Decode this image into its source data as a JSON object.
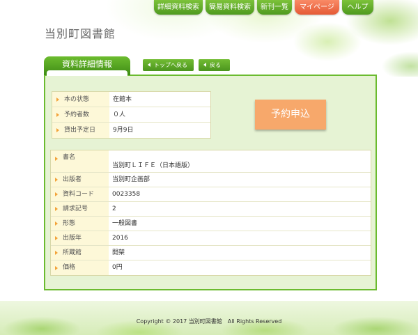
{
  "nav": {
    "items": [
      {
        "label": "詳細資料検索"
      },
      {
        "label": "簡易資料検索"
      },
      {
        "label": "新刊一覧"
      },
      {
        "label": "マイページ"
      },
      {
        "label": "ヘルプ"
      }
    ]
  },
  "site": {
    "title": "当別町図書館"
  },
  "section": {
    "tab_label": "資料詳細情報",
    "top_button": "トップへ戻る",
    "back_button": "戻る"
  },
  "status": {
    "rows": [
      {
        "label": "本の状態",
        "value": "在館本"
      },
      {
        "label": "予約者数",
        "value": "０人"
      },
      {
        "label": "貸出予定日",
        "value": "9月9日"
      }
    ]
  },
  "reserve_button": "予約申込",
  "details": {
    "rows": [
      {
        "label": "書名",
        "value": "当別町ＬＩＦＥ（日本語版）"
      },
      {
        "label": "出版者",
        "value": "当別町企画部"
      },
      {
        "label": "資料コード",
        "value": "0023358"
      },
      {
        "label": "請求記号",
        "value": "2"
      },
      {
        "label": "形態",
        "value": "一般図書"
      },
      {
        "label": "出版年",
        "value": "2016"
      },
      {
        "label": "所蔵館",
        "value": "開架"
      },
      {
        "label": "価格",
        "value": "0円"
      }
    ]
  },
  "footer": {
    "copyright": "Copyright © 2017 当別町図書館　All Rights Reserved"
  },
  "colors": {
    "nav_green": "#5aa628",
    "mypage_orange": "#ef7550",
    "panel_border": "#6bbb2f",
    "panel_bg": "#e6f3d4",
    "reserve_orange": "#f7a86b"
  }
}
